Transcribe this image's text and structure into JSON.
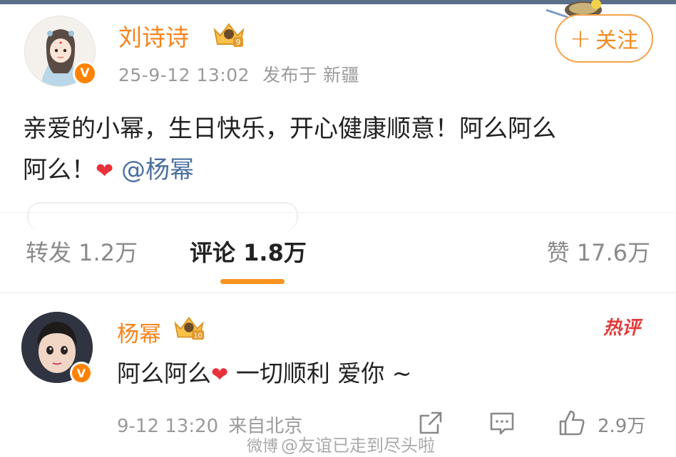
{
  "post": {
    "username": "刘诗诗",
    "crown_level": "9",
    "verified_mark": "V",
    "date": "25-9-12 13:02",
    "location": "发布于 新疆",
    "follow_label": "关注",
    "follow_plus": "+",
    "text_line1": "亲爱的小幂，生日快乐，开心健康顺意！阿么阿么",
    "text_line2_prefix": "阿么！",
    "heart_icon": "❤",
    "mention": "@杨幂"
  },
  "tabs": {
    "repost": "转发 1.2万",
    "comment": "评论 1.8万",
    "like": "赞 17.6万",
    "active": "comment",
    "accent_color": "#f7931e"
  },
  "comment": {
    "username": "杨幂",
    "crown_level": "10",
    "verified_mark": "V",
    "hot_badge": "热评",
    "text_prefix": "阿么阿么",
    "heart_icon": "❤",
    "text_suffix": "一切顺利 爱你 ~",
    "time": "9-12 13:20",
    "location": "来自北京",
    "like_count": "2.9万",
    "icons": [
      "share-icon",
      "comment-icon",
      "like-icon"
    ]
  },
  "watermark": {
    "logo": "微博",
    "text": "@友谊已走到尽头啦"
  },
  "colors": {
    "username": "#f7831b",
    "mention": "#4b6f9f",
    "verified": "#ff8200",
    "hot": "#e23a3a"
  }
}
